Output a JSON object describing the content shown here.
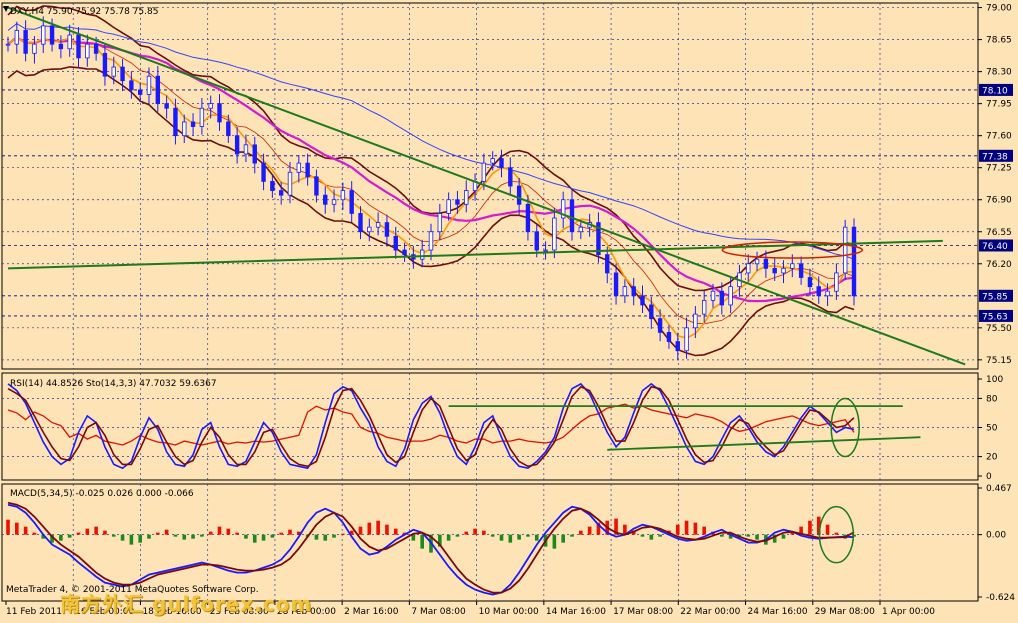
{
  "colors": {
    "background": "#FDE3B6",
    "grid": "#333399",
    "bull_candle": "#1a1aff",
    "bear_candle": "#1a1aff",
    "trendline": "#1d7a1d",
    "magenta_ma": "#d41bd4",
    "orange_ma": "#ff9900",
    "cyan_ma": "#33ccee",
    "brown_band": "#6b0f0f",
    "red_ma": "#cc2200",
    "blue_ma": "#3344ff",
    "rsi": "#dd1100",
    "stoch_main": "#1a1aff",
    "stoch_signal": "#7a0a0a",
    "hist_pos": "#ee1100",
    "hist_neg": "#1a8a1a",
    "highlight_circle": "#1d7a1d",
    "price_marker": "#000080"
  },
  "chart_data": [
    {
      "type": "line",
      "panel": "main",
      "title": "DXY,H4 75.90 75.92 75.78 75.85",
      "symbol": "DXY",
      "timeframe": "H4",
      "ohlc": {
        "open": 75.9,
        "high": 75.92,
        "low": 75.78,
        "close": 75.85
      },
      "ylim": [
        75.05,
        79.05
      ],
      "y_ticks": [
        79.0,
        78.65,
        78.3,
        77.95,
        77.6,
        77.25,
        76.9,
        76.55,
        76.2,
        75.5,
        75.15
      ],
      "price_markers": [
        "78.10",
        "77.38",
        "76.40",
        "75.85",
        "75.63"
      ],
      "price_marker_values": [
        78.1,
        77.38,
        76.4,
        75.85,
        75.63
      ],
      "x_labels": [
        "11 Feb 2011",
        "16 Feb 00:00",
        "18 Feb 16:00",
        "23 Feb 08:00",
        "28 Feb 00:00",
        "2 Mar 16:00",
        "7 Mar 08:00",
        "10 Mar 00:00",
        "14 Mar 16:00",
        "17 Mar 08:00",
        "22 Mar 00:00",
        "24 Mar 16:00",
        "29 Mar 08:00",
        "1 Apr 00:00"
      ],
      "series": [
        {
          "values": [
            78.6,
            78.75,
            78.5,
            78.6,
            78.8,
            78.6,
            78.55,
            78.7,
            78.45,
            78.6,
            78.5,
            78.25,
            78.35,
            78.2,
            78.1,
            78.05,
            78.25,
            77.95,
            77.9,
            77.6,
            77.75,
            77.7,
            77.9,
            77.95,
            77.75,
            77.6,
            77.4,
            77.5,
            77.3,
            77.1,
            77.0,
            76.95,
            77.2,
            77.3,
            77.15,
            76.95,
            76.85,
            76.9,
            77.0,
            76.75,
            76.55,
            76.6,
            76.65,
            76.5,
            76.35,
            76.3,
            76.25,
            76.35,
            76.55,
            76.75,
            76.9,
            76.85,
            77.0,
            77.1,
            77.3,
            77.35,
            77.25,
            77.05,
            76.85,
            76.55,
            76.35,
            76.35,
            76.7,
            76.9,
            76.55,
            76.6,
            76.65,
            76.3,
            76.1,
            75.85,
            75.95,
            75.85,
            75.75,
            75.6,
            75.45,
            75.35,
            75.25,
            75.5,
            75.65,
            75.8,
            75.9,
            75.75,
            75.95,
            76.1,
            76.2,
            76.25,
            76.15,
            76.1,
            76.15,
            76.2,
            76.05,
            75.95,
            75.85,
            75.9,
            76.1,
            76.6,
            75.85
          ]
        }
      ],
      "trendlines": [
        {
          "from": [
            0,
            79.0
          ],
          "to": [
            95,
            75.55
          ]
        },
        {
          "from": [
            0,
            76.15
          ],
          "to": [
            97,
            76.45
          ]
        }
      ]
    },
    {
      "type": "line",
      "panel": "rsi_stoch",
      "title": "RSI(14) 44.8526 Sto(14,3,3) 47.7032 59.6367",
      "ylim": [
        0,
        100
      ],
      "y_ticks": [
        100,
        80,
        50,
        20,
        0
      ],
      "series": [
        {
          "name": "RSI(14)",
          "values": [
            68,
            65,
            58,
            66,
            62,
            55,
            52,
            40,
            44,
            38,
            42,
            36,
            34,
            32,
            36,
            42,
            38,
            35,
            34,
            32,
            36,
            34,
            32,
            34,
            36,
            33,
            35,
            34,
            36,
            35,
            36,
            38,
            40,
            42,
            66,
            72,
            68,
            70,
            66,
            64,
            50,
            46,
            44,
            40,
            38,
            36,
            36,
            36,
            38,
            42,
            40,
            36,
            34,
            38,
            38,
            34,
            36,
            36,
            38,
            36,
            35,
            34,
            36,
            40,
            48,
            56,
            62,
            64,
            70,
            72,
            74,
            70,
            72,
            68,
            66,
            64,
            62,
            60,
            64,
            62,
            60,
            56,
            50,
            46,
            48,
            52,
            56,
            58,
            60,
            62,
            58,
            54,
            52,
            54,
            56,
            58,
            45
          ]
        },
        {
          "name": "Sto(14,3,3)",
          "values": [
            95,
            88,
            75,
            55,
            35,
            20,
            12,
            18,
            45,
            62,
            55,
            30,
            12,
            8,
            15,
            40,
            60,
            48,
            25,
            12,
            10,
            22,
            48,
            55,
            30,
            12,
            10,
            15,
            35,
            55,
            45,
            25,
            12,
            10,
            8,
            22,
            55,
            85,
            92,
            88,
            70,
            55,
            30,
            15,
            10,
            28,
            58,
            75,
            82,
            65,
            40,
            20,
            12,
            30,
            55,
            62,
            40,
            20,
            10,
            8,
            15,
            25,
            40,
            70,
            90,
            95,
            85,
            65,
            45,
            30,
            40,
            65,
            88,
            95,
            88,
            70,
            50,
            30,
            15,
            12,
            20,
            38,
            55,
            62,
            50,
            35,
            25,
            20,
            30,
            45,
            60,
            72,
            65,
            55,
            45,
            50,
            48
          ]
        },
        {
          "name": "Sto signal",
          "values": [
            90,
            85,
            78,
            62,
            45,
            30,
            18,
            16,
            30,
            50,
            55,
            42,
            22,
            12,
            12,
            28,
            48,
            52,
            35,
            20,
            12,
            16,
            35,
            50,
            40,
            22,
            12,
            12,
            25,
            45,
            48,
            32,
            18,
            12,
            10,
            15,
            40,
            70,
            88,
            90,
            78,
            62,
            42,
            22,
            14,
            20,
            45,
            68,
            80,
            72,
            50,
            28,
            16,
            22,
            45,
            58,
            48,
            28,
            15,
            10,
            12,
            22,
            35,
            58,
            82,
            92,
            88,
            72,
            52,
            36,
            36,
            55,
            78,
            92,
            90,
            78,
            58,
            38,
            22,
            14,
            16,
            30,
            48,
            58,
            54,
            40,
            30,
            22,
            26,
            40,
            55,
            68,
            66,
            58,
            50,
            52,
            60
          ]
        }
      ],
      "trendlines": [
        {
          "from": [
            50,
            72
          ],
          "to": [
            97,
            72
          ]
        },
        {
          "from": [
            68,
            27
          ],
          "to": [
            99,
            40
          ]
        }
      ]
    },
    {
      "type": "bar",
      "panel": "macd",
      "title": "MACD(5,34,5) -0.025 0.026 0.000 -0.066",
      "ylim": [
        -0.624,
        0.467
      ],
      "y_ticks": [
        0.467,
        0.0,
        -0.624
      ],
      "y_tick_labels": [
        "0.467",
        "0.00",
        "-0.624"
      ],
      "series": [
        {
          "name": "Histogram",
          "values": [
            0.15,
            0.12,
            0.08,
            0.02,
            -0.04,
            -0.08,
            -0.06,
            -0.03,
            0.02,
            0.06,
            0.08,
            0.04,
            -0.02,
            -0.06,
            -0.1,
            -0.08,
            -0.04,
            0.02,
            0.05,
            -0.02,
            -0.05,
            -0.04,
            -0.02,
            0.03,
            0.08,
            0.06,
            0.02,
            -0.04,
            -0.08,
            -0.06,
            -0.03,
            0.02,
            0.05,
            0.03,
            -0.02,
            -0.05,
            -0.06,
            -0.03,
            0.01,
            0.04,
            0.08,
            0.12,
            0.14,
            0.1,
            0.06,
            0.02,
            -0.06,
            -0.14,
            -0.18,
            -0.12,
            -0.06,
            -0.02,
            0.03,
            0.06,
            0.04,
            -0.02,
            -0.06,
            -0.08,
            -0.05,
            -0.02,
            -0.06,
            -0.12,
            -0.14,
            -0.08,
            -0.02,
            0.04,
            0.08,
            0.12,
            0.14,
            0.16,
            0.1,
            0.04,
            -0.02,
            -0.05,
            -0.02,
            0.04,
            0.1,
            0.14,
            0.12,
            0.08,
            0.03,
            -0.02,
            -0.04,
            -0.03,
            -0.02,
            -0.05,
            -0.1,
            -0.08,
            -0.04,
            0.02,
            0.08,
            0.14,
            0.18,
            0.1,
            0.02,
            -0.04,
            -0.02
          ]
        },
        {
          "name": "Main",
          "values": [
            0.3,
            0.28,
            0.22,
            0.12,
            0.0,
            -0.1,
            -0.15,
            -0.2,
            -0.28,
            -0.35,
            -0.42,
            -0.48,
            -0.5,
            -0.52,
            -0.5,
            -0.45,
            -0.4,
            -0.38,
            -0.36,
            -0.34,
            -0.32,
            -0.3,
            -0.28,
            -0.3,
            -0.33,
            -0.36,
            -0.38,
            -0.38,
            -0.36,
            -0.33,
            -0.3,
            -0.25,
            -0.15,
            -0.02,
            0.12,
            0.22,
            0.26,
            0.22,
            0.12,
            -0.02,
            -0.14,
            -0.2,
            -0.18,
            -0.12,
            -0.05,
            0.0,
            0.05,
            0.02,
            -0.08,
            -0.2,
            -0.32,
            -0.42,
            -0.5,
            -0.55,
            -0.58,
            -0.6,
            -0.58,
            -0.5,
            -0.38,
            -0.24,
            -0.1,
            0.02,
            0.12,
            0.22,
            0.28,
            0.26,
            0.2,
            0.1,
            0.02,
            -0.02,
            0.0,
            0.06,
            0.1,
            0.08,
            0.04,
            0.0,
            -0.04,
            -0.06,
            -0.05,
            -0.02,
            0.02,
            0.05,
            0.0,
            -0.04,
            -0.08,
            -0.08,
            -0.05,
            0.02,
            0.05,
            0.03,
            -0.01,
            -0.03,
            -0.04,
            -0.03,
            -0.025,
            -0.02,
            -0.025
          ]
        },
        {
          "name": "Signal",
          "values": [
            0.32,
            0.3,
            0.26,
            0.18,
            0.08,
            -0.02,
            -0.1,
            -0.16,
            -0.22,
            -0.3,
            -0.38,
            -0.44,
            -0.48,
            -0.5,
            -0.5,
            -0.48,
            -0.44,
            -0.4,
            -0.38,
            -0.36,
            -0.34,
            -0.32,
            -0.3,
            -0.3,
            -0.31,
            -0.33,
            -0.35,
            -0.36,
            -0.36,
            -0.35,
            -0.33,
            -0.3,
            -0.24,
            -0.14,
            -0.02,
            0.1,
            0.18,
            0.22,
            0.18,
            0.08,
            -0.04,
            -0.12,
            -0.16,
            -0.14,
            -0.09,
            -0.04,
            0.01,
            0.02,
            -0.02,
            -0.1,
            -0.22,
            -0.34,
            -0.44,
            -0.5,
            -0.55,
            -0.58,
            -0.58,
            -0.54,
            -0.46,
            -0.34,
            -0.2,
            -0.06,
            0.06,
            0.16,
            0.24,
            0.26,
            0.22,
            0.15,
            0.07,
            0.02,
            0.0,
            0.03,
            0.07,
            0.08,
            0.06,
            0.02,
            -0.02,
            -0.04,
            -0.05,
            -0.04,
            -0.01,
            0.02,
            0.02,
            -0.02,
            -0.05,
            -0.07,
            -0.06,
            -0.02,
            0.02,
            0.03,
            0.01,
            -0.01,
            -0.03,
            -0.03,
            -0.027,
            -0.024,
            0.026
          ]
        }
      ]
    }
  ],
  "footer": {
    "copyright": "MetaTrader 4, © 2001-2011 MetaQuotes Software Corp.",
    "watermark": "南方外汇 gulforex.com"
  },
  "icons": {
    "chart_marker": "triangle-marker-icon"
  }
}
